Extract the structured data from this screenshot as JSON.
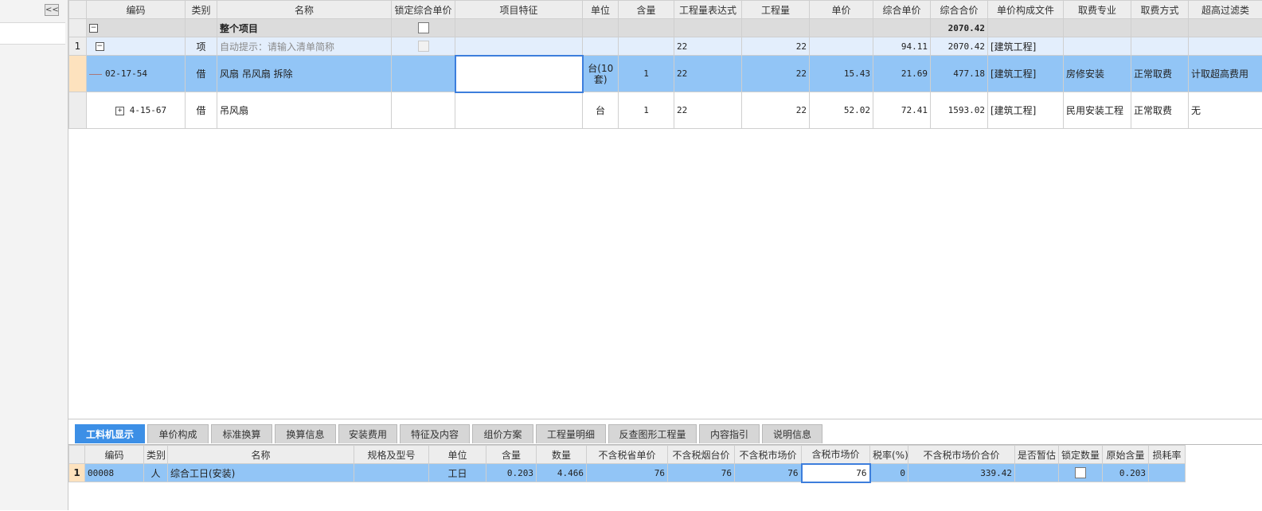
{
  "sidebar": {
    "collapse_label": "<<"
  },
  "main_table": {
    "columns": [
      "编码",
      "类别",
      "名称",
      "锁定综合单价",
      "项目特征",
      "单位",
      "含量",
      "工程量表达式",
      "工程量",
      "单价",
      "综合单价",
      "综合合价",
      "单价构成文件",
      "取费专业",
      "取费方式",
      "超高过滤类"
    ],
    "whole_project": {
      "toggle": "−",
      "name": "整个项目",
      "total": "2070.42"
    },
    "item_row": {
      "index": "1",
      "toggle": "−",
      "category": "项",
      "name_hint": "自动提示：请输入清单简称",
      "expr": "22",
      "qty": "22",
      "unit_price_comp": "94.11",
      "total_comp": "2070.42",
      "file": "[建筑工程]"
    },
    "rows": [
      {
        "code": "02-17-54",
        "category": "借",
        "name": "风扇 吊风扇 拆除",
        "unit": "台(10套)",
        "content": "1",
        "expr": "22",
        "qty": "22",
        "unit_price": "15.43",
        "unit_price_comp": "21.69",
        "total_comp": "477.18",
        "file": "[建筑工程]",
        "specialty": "房修安装",
        "fee_method": "正常取费",
        "height_filter": "计取超高费用"
      },
      {
        "toggle": "+",
        "code": "4-15-67",
        "category": "借",
        "name": "吊风扇",
        "unit": "台",
        "content": "1",
        "expr": "22",
        "qty": "22",
        "unit_price": "52.02",
        "unit_price_comp": "72.41",
        "total_comp": "1593.02",
        "file": "[建筑工程]",
        "specialty": "民用安装工程",
        "fee_method": "正常取费",
        "height_filter": "无"
      }
    ]
  },
  "tabs": [
    "工料机显示",
    "单价构成",
    "标准换算",
    "换算信息",
    "安装费用",
    "特征及内容",
    "组价方案",
    "工程量明细",
    "反查图形工程量",
    "内容指引",
    "说明信息"
  ],
  "sub_table": {
    "columns": [
      "编码",
      "类别",
      "名称",
      "规格及型号",
      "单位",
      "含量",
      "数量",
      "不含税省单价",
      "不含税烟台价",
      "不含税市场价",
      "含税市场价",
      "税率(%)",
      "不含税市场价合价",
      "是否暂估",
      "锁定数量",
      "原始含量",
      "损耗率"
    ],
    "rows": [
      {
        "index": "1",
        "code": "00008",
        "category": "人",
        "name": "综合工日(安装)",
        "spec": "",
        "unit": "工日",
        "content": "0.203",
        "qty": "4.466",
        "prov_price": "76",
        "yt_price": "76",
        "market_price": "76",
        "tax_market_price": "76",
        "tax_rate": "0",
        "market_total": "339.42",
        "orig_content": "0.203"
      }
    ]
  }
}
